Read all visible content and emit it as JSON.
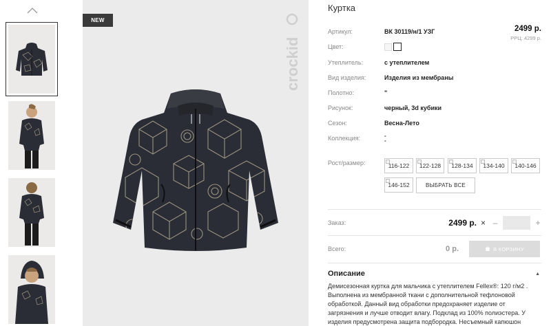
{
  "gallery": {
    "badge": "NEW",
    "brand": "crockid"
  },
  "product": {
    "title": "Куртка",
    "price": "2499 р.",
    "rrp": "РРЦ: 4299 р.",
    "attributes": [
      {
        "label": "Артикул:",
        "value": "ВК 30119/н/1 УЗГ"
      },
      {
        "label": "Цвет:",
        "value": ""
      },
      {
        "label": "Утеплитель:",
        "value": "с утеплителем"
      },
      {
        "label": "Вид изделия:",
        "value": "Изделия из мембраны"
      },
      {
        "label": "Полотно:",
        "value": "\""
      },
      {
        "label": "Рисунок:",
        "value": "черный, 3d кубики"
      },
      {
        "label": "Сезон:",
        "value": "Весна-Лето"
      },
      {
        "label": "Коллекция:",
        "value": "-"
      }
    ],
    "collection_dash_2": "-"
  },
  "sizes": {
    "label": "Рост/размер:",
    "options": [
      "116-122",
      "122-128",
      "128-134",
      "134-140",
      "140-146",
      "146-152"
    ],
    "select_all": "ВЫБРАТЬ ВСЕ"
  },
  "order": {
    "label": "Заказ:",
    "price": "2499 р.",
    "remove": "×",
    "minus": "–",
    "plus": "+"
  },
  "total": {
    "label": "Всего:",
    "value": "0 р.",
    "cart_button": "В КОРЗИНУ"
  },
  "description": {
    "title": "Описание",
    "text": "Демисезонная куртка для мальчика с утеплителем Fellex®: 120 г/м2 . Выполнена из мембранной ткани с дополнительной тефлоновой обработкой. Данный вид обработки предохраняет изделие от загрязнения и лучше отводит влагу. Подклад из 100% полиэстера. У изделия предусмотрена защита подбородка. Несъемный капюшон"
  },
  "colors": {
    "jacket": "#2b2d36",
    "pattern": "#b9ae95",
    "badge_bg": "#3a3a3a",
    "cart_bg": "#dcdcdc"
  }
}
